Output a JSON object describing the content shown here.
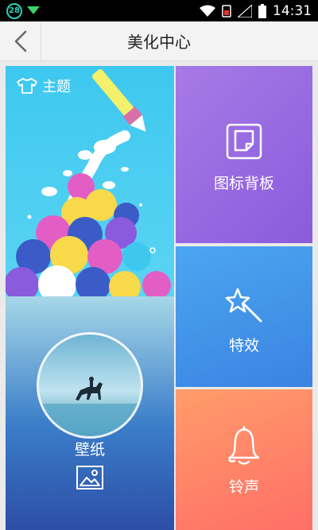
{
  "status_bar": {
    "badge": "28",
    "time": "14:31"
  },
  "header": {
    "title": "美化中心"
  },
  "tiles": {
    "theme": {
      "label": "主题"
    },
    "wallpaper": {
      "label": "壁纸"
    },
    "icon_bg": {
      "label": "图标背板"
    },
    "effects": {
      "label": "特效"
    },
    "ringtone": {
      "label": "铃声"
    }
  },
  "colors": {
    "theme_bg": "#3ec8f0",
    "wallpaper_bg": "#3b7ec9",
    "icon_bg": "#a77ae6",
    "effects_bg": "#4ca6f0",
    "ringtone_bg": "#ff9c6b"
  },
  "icons": [
    "back-icon",
    "shirt-icon",
    "sticky-note-icon",
    "magic-wand-icon",
    "bell-icon",
    "image-icon",
    "wifi-icon",
    "battery-icon",
    "signal-icon"
  ]
}
